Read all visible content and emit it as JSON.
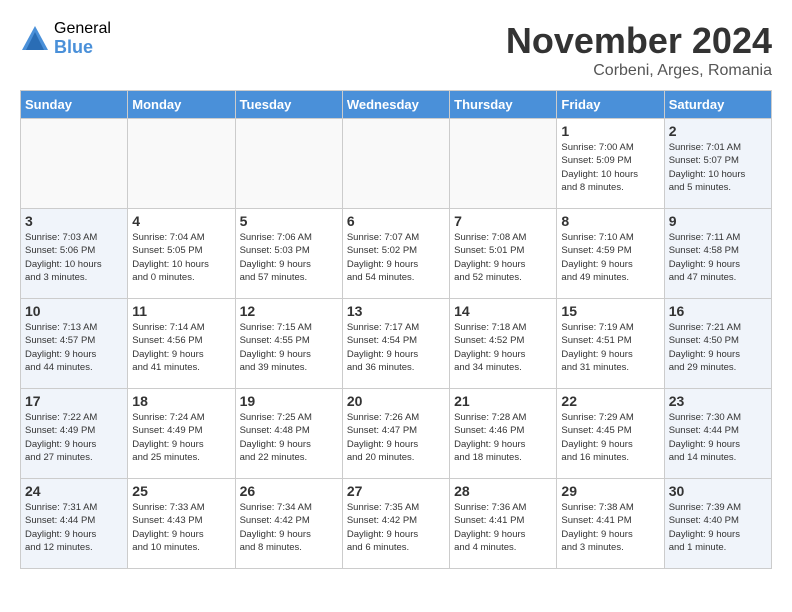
{
  "header": {
    "logo_general": "General",
    "logo_blue": "Blue",
    "month_title": "November 2024",
    "subtitle": "Corbeni, Arges, Romania"
  },
  "weekdays": [
    "Sunday",
    "Monday",
    "Tuesday",
    "Wednesday",
    "Thursday",
    "Friday",
    "Saturday"
  ],
  "weeks": [
    [
      {
        "day": "",
        "info": ""
      },
      {
        "day": "",
        "info": ""
      },
      {
        "day": "",
        "info": ""
      },
      {
        "day": "",
        "info": ""
      },
      {
        "day": "",
        "info": ""
      },
      {
        "day": "1",
        "info": "Sunrise: 7:00 AM\nSunset: 5:09 PM\nDaylight: 10 hours\nand 8 minutes."
      },
      {
        "day": "2",
        "info": "Sunrise: 7:01 AM\nSunset: 5:07 PM\nDaylight: 10 hours\nand 5 minutes."
      }
    ],
    [
      {
        "day": "3",
        "info": "Sunrise: 7:03 AM\nSunset: 5:06 PM\nDaylight: 10 hours\nand 3 minutes."
      },
      {
        "day": "4",
        "info": "Sunrise: 7:04 AM\nSunset: 5:05 PM\nDaylight: 10 hours\nand 0 minutes."
      },
      {
        "day": "5",
        "info": "Sunrise: 7:06 AM\nSunset: 5:03 PM\nDaylight: 9 hours\nand 57 minutes."
      },
      {
        "day": "6",
        "info": "Sunrise: 7:07 AM\nSunset: 5:02 PM\nDaylight: 9 hours\nand 54 minutes."
      },
      {
        "day": "7",
        "info": "Sunrise: 7:08 AM\nSunset: 5:01 PM\nDaylight: 9 hours\nand 52 minutes."
      },
      {
        "day": "8",
        "info": "Sunrise: 7:10 AM\nSunset: 4:59 PM\nDaylight: 9 hours\nand 49 minutes."
      },
      {
        "day": "9",
        "info": "Sunrise: 7:11 AM\nSunset: 4:58 PM\nDaylight: 9 hours\nand 47 minutes."
      }
    ],
    [
      {
        "day": "10",
        "info": "Sunrise: 7:13 AM\nSunset: 4:57 PM\nDaylight: 9 hours\nand 44 minutes."
      },
      {
        "day": "11",
        "info": "Sunrise: 7:14 AM\nSunset: 4:56 PM\nDaylight: 9 hours\nand 41 minutes."
      },
      {
        "day": "12",
        "info": "Sunrise: 7:15 AM\nSunset: 4:55 PM\nDaylight: 9 hours\nand 39 minutes."
      },
      {
        "day": "13",
        "info": "Sunrise: 7:17 AM\nSunset: 4:54 PM\nDaylight: 9 hours\nand 36 minutes."
      },
      {
        "day": "14",
        "info": "Sunrise: 7:18 AM\nSunset: 4:52 PM\nDaylight: 9 hours\nand 34 minutes."
      },
      {
        "day": "15",
        "info": "Sunrise: 7:19 AM\nSunset: 4:51 PM\nDaylight: 9 hours\nand 31 minutes."
      },
      {
        "day": "16",
        "info": "Sunrise: 7:21 AM\nSunset: 4:50 PM\nDaylight: 9 hours\nand 29 minutes."
      }
    ],
    [
      {
        "day": "17",
        "info": "Sunrise: 7:22 AM\nSunset: 4:49 PM\nDaylight: 9 hours\nand 27 minutes."
      },
      {
        "day": "18",
        "info": "Sunrise: 7:24 AM\nSunset: 4:49 PM\nDaylight: 9 hours\nand 25 minutes."
      },
      {
        "day": "19",
        "info": "Sunrise: 7:25 AM\nSunset: 4:48 PM\nDaylight: 9 hours\nand 22 minutes."
      },
      {
        "day": "20",
        "info": "Sunrise: 7:26 AM\nSunset: 4:47 PM\nDaylight: 9 hours\nand 20 minutes."
      },
      {
        "day": "21",
        "info": "Sunrise: 7:28 AM\nSunset: 4:46 PM\nDaylight: 9 hours\nand 18 minutes."
      },
      {
        "day": "22",
        "info": "Sunrise: 7:29 AM\nSunset: 4:45 PM\nDaylight: 9 hours\nand 16 minutes."
      },
      {
        "day": "23",
        "info": "Sunrise: 7:30 AM\nSunset: 4:44 PM\nDaylight: 9 hours\nand 14 minutes."
      }
    ],
    [
      {
        "day": "24",
        "info": "Sunrise: 7:31 AM\nSunset: 4:44 PM\nDaylight: 9 hours\nand 12 minutes."
      },
      {
        "day": "25",
        "info": "Sunrise: 7:33 AM\nSunset: 4:43 PM\nDaylight: 9 hours\nand 10 minutes."
      },
      {
        "day": "26",
        "info": "Sunrise: 7:34 AM\nSunset: 4:42 PM\nDaylight: 9 hours\nand 8 minutes."
      },
      {
        "day": "27",
        "info": "Sunrise: 7:35 AM\nSunset: 4:42 PM\nDaylight: 9 hours\nand 6 minutes."
      },
      {
        "day": "28",
        "info": "Sunrise: 7:36 AM\nSunset: 4:41 PM\nDaylight: 9 hours\nand 4 minutes."
      },
      {
        "day": "29",
        "info": "Sunrise: 7:38 AM\nSunset: 4:41 PM\nDaylight: 9 hours\nand 3 minutes."
      },
      {
        "day": "30",
        "info": "Sunrise: 7:39 AM\nSunset: 4:40 PM\nDaylight: 9 hours\nand 1 minute."
      }
    ]
  ]
}
